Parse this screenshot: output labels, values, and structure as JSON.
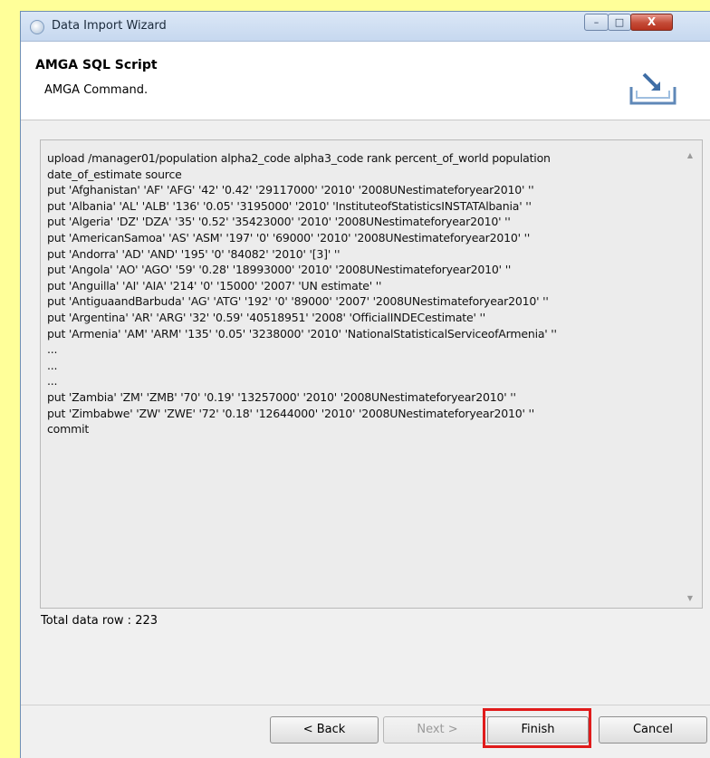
{
  "window": {
    "title": "Data Import Wizard",
    "minimize": "–",
    "maximize": "□",
    "close": "X"
  },
  "header": {
    "title": "AMGA SQL Script",
    "subtitle": "AMGA Command.",
    "icon": "import-arrow-icon"
  },
  "script": {
    "lines": [
      "upload /manager01/population  alpha2_code alpha3_code rank percent_of_world population",
      "date_of_estimate source",
      "put 'Afghanistan' 'AF' 'AFG' '42' '0.42' '29117000' '2010' '2008UNestimateforyear2010' ''",
      "put 'Albania' 'AL' 'ALB' '136' '0.05' '3195000' '2010' 'InstituteofStatisticsINSTATAlbania' ''",
      "put 'Algeria' 'DZ' 'DZA' '35' '0.52' '35423000' '2010' '2008UNestimateforyear2010' ''",
      "put 'AmericanSamoa' 'AS' 'ASM' '197' '0' '69000' '2010' '2008UNestimateforyear2010' ''",
      "put 'Andorra' 'AD' 'AND' '195' '0' '84082' '2010' '[3]' ''",
      "put 'Angola' 'AO' 'AGO' '59' '0.28' '18993000' '2010' '2008UNestimateforyear2010' ''",
      "put 'Anguilla' 'AI' 'AIA' '214' '0' '15000' '2007' 'UN estimate' ''",
      "put 'AntiguaandBarbuda' 'AG' 'ATG' '192' '0' '89000' '2007' '2008UNestimateforyear2010' ''",
      "put 'Argentina' 'AR' 'ARG' '32' '0.59' '40518951' '2008' 'OfficialINDECestimate' ''",
      "put 'Armenia' 'AM' 'ARM' '135' '0.05' '3238000' '2010' 'NationalStatisticalServiceofArmenia' ''",
      "...",
      "...",
      "...",
      "put 'Zambia' 'ZM' 'ZMB' '70' '0.19' '13257000' '2010' '2008UNestimateforyear2010' ''",
      "put 'Zimbabwe' 'ZW' 'ZWE' '72' '0.18' '12644000' '2010' '2008UNestimateforyear2010' ''",
      "commit"
    ]
  },
  "total_label": "Total data row : 223",
  "buttons": {
    "back": "< Back",
    "next": "Next >",
    "finish": "Finish",
    "cancel": "Cancel"
  },
  "colors": {
    "background": "#ffff99",
    "highlight": "#e01b1b"
  }
}
